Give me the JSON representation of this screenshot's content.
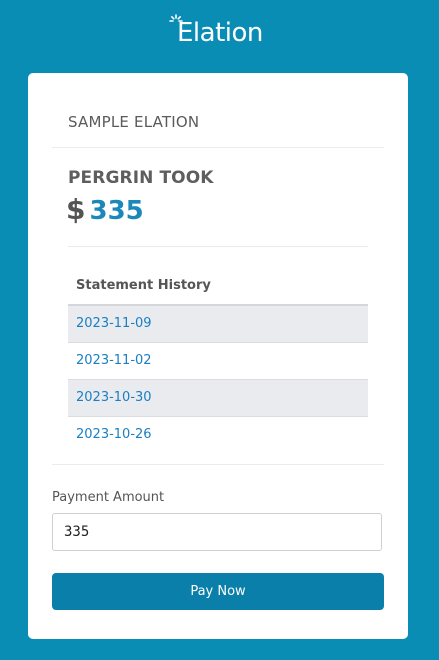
{
  "brand": {
    "logo_text": "Elation",
    "accent": "#0a8db5"
  },
  "card": {
    "practice_name": "SAMPLE ELATION",
    "patient_name": "PERGRIN TOOK",
    "currency_symbol": "$",
    "balance": "335",
    "balance_color": "#1a88b8"
  },
  "statement_history": {
    "header": "Statement History",
    "rows": [
      {
        "date": "2023-11-09"
      },
      {
        "date": "2023-11-02"
      },
      {
        "date": "2023-10-30"
      },
      {
        "date": "2023-10-26"
      }
    ]
  },
  "payment": {
    "label": "Payment Amount",
    "value": "335",
    "button_label": "Pay Now",
    "button_color": "#0a7faa"
  }
}
